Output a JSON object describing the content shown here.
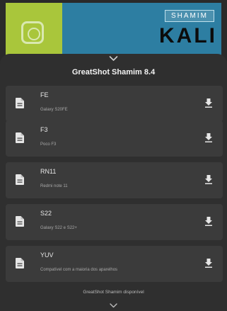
{
  "banner": {
    "tag": "SHAMIM",
    "word": "KALI"
  },
  "sheet": {
    "title": "GreatShot Shamim 8.4",
    "items": [
      {
        "title": "FE",
        "subtitle": "Galaxy S20FE"
      },
      {
        "title": "F3",
        "subtitle": "Poco F3"
      },
      {
        "title": "RN11",
        "subtitle": "Redmi note 11"
      },
      {
        "title": "S22",
        "subtitle": "Galaxy S22 e S22+"
      },
      {
        "title": "YUV",
        "subtitle": "Compatível com a maioria dos aparelhos"
      }
    ],
    "footer": "GreatShot Shamim disponível"
  },
  "colors": {
    "sheet_bg": "#2f2f2f",
    "card_bg": "#3b3b3b",
    "text": "#e8e8e8",
    "banner_green": "#a9c63b",
    "banner_blue": "#2d7ea2"
  },
  "icons": {
    "file": "document-icon",
    "download": "download-icon",
    "collapse": "chevron-down-icon"
  }
}
